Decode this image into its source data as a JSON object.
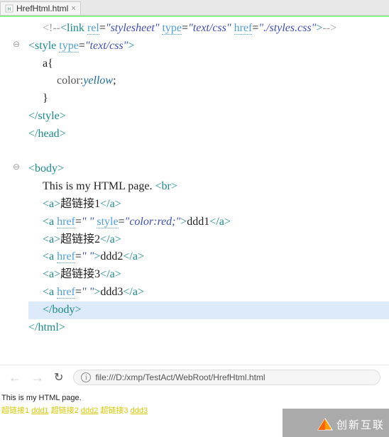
{
  "tab": {
    "filename": "HrefHtml.html"
  },
  "code": {
    "lines": [
      {
        "indent": 1,
        "raw": "<!--<link rel=\"stylesheet\" type=\"text/css\" href=\"./styles.css\">-->"
      },
      {
        "indent": 0,
        "marker": "⊖",
        "raw": "<style type=\"text/css\">"
      },
      {
        "indent": 1,
        "raw": "a{"
      },
      {
        "indent": 2,
        "raw": "color:yellow;"
      },
      {
        "indent": 1,
        "raw": "}"
      },
      {
        "indent": 0,
        "raw": "</style>"
      },
      {
        "indent": 0,
        "raw": "</head>"
      },
      {
        "indent": 0,
        "raw": ""
      },
      {
        "indent": 0,
        "marker": "⊖",
        "raw": "<body>"
      },
      {
        "indent": 1,
        "raw": "This is my HTML page. <br>"
      },
      {
        "indent": 1,
        "raw": "<a>超链接1</a>"
      },
      {
        "indent": 1,
        "raw": "<a href=\" \" style=\"color:red;\">ddd1</a>"
      },
      {
        "indent": 1,
        "raw": "<a>超链接2</a>"
      },
      {
        "indent": 1,
        "raw": "<a href=\" \">ddd2</a>"
      },
      {
        "indent": 1,
        "raw": "<a>超链接3</a>"
      },
      {
        "indent": 1,
        "raw": "<a href=\" \">ddd3</a>"
      },
      {
        "indent": 1,
        "highlight": true,
        "raw": "</body>"
      },
      {
        "indent": 0,
        "raw": "</html>"
      }
    ]
  },
  "browser": {
    "back": "←",
    "fwd": "→",
    "reload": "↻",
    "url": "file:///D:/xmp/TestAct/WebRoot/HrefHtml.html"
  },
  "page": {
    "text": "This is my HTML page.",
    "links": [
      {
        "t": "超链接1",
        "u": false
      },
      {
        "t": "ddd1",
        "u": true
      },
      {
        "t": "超链接2",
        "u": false
      },
      {
        "t": "ddd2",
        "u": true
      },
      {
        "t": "超链接3",
        "u": false
      },
      {
        "t": "ddd3",
        "u": true
      }
    ]
  },
  "watermark": "创新互联"
}
